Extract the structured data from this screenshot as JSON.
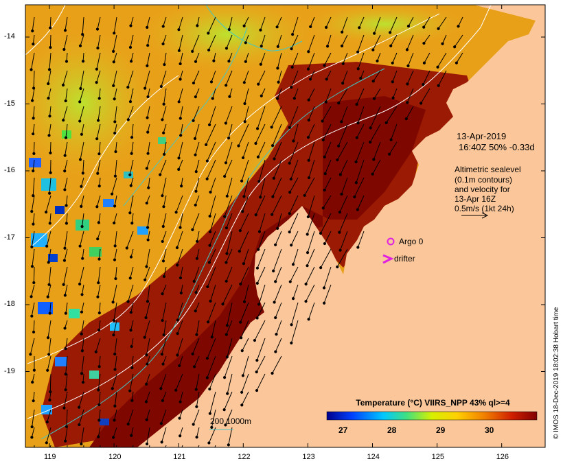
{
  "map": {
    "title_date": "13-Apr-2019",
    "title_time": "16:40Z  50% -0.33d",
    "legend_lines": [
      "Altimetric sealevel",
      "(0.1m contours)",
      "and velocity for",
      "13-Apr 16Z",
      "0.5m/s (1kt 24h)"
    ],
    "argo_label": "Argo 0",
    "drifter_label": "drifter",
    "depth_label": "200  1000m",
    "credit": "© IMOS 18-Dec-2019 18:02:38 Hobart time",
    "colorbar_title": "Temperature (°C) VIIRS_NPP 43% ql>=4",
    "colorbar_ticks": [
      "27",
      "28",
      "29",
      "30"
    ],
    "x_ticks": [
      "119",
      "120",
      "121",
      "122",
      "123",
      "124",
      "125",
      "126"
    ],
    "y_ticks": [
      "-14",
      "-15",
      "-16",
      "-17",
      "-18",
      "-19"
    ],
    "colors": {
      "land": "#fbc79a",
      "ocean_warm": "#e8a018",
      "ocean_hot": "#8b0a00",
      "ocean_cool": "#c8e020",
      "argo": "#e020e0",
      "contour_sealevel": "#ffffff",
      "contour_bathy": "#40c8c8"
    }
  }
}
